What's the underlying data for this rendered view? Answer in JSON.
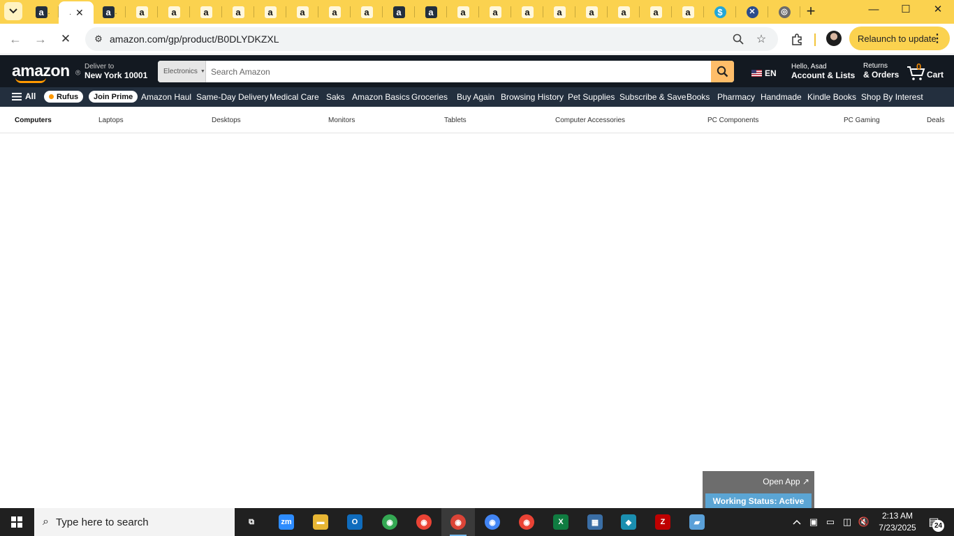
{
  "browser": {
    "tabs": [
      {
        "icon": "amazon-dark-icon",
        "glyph": "a",
        "style": "dark",
        "dot": "."
      },
      {
        "icon": "amazon-icon",
        "glyph": "",
        "style": "active",
        "dot": "."
      },
      {
        "icon": "amazon-dark-icon",
        "glyph": "a",
        "style": "dark",
        "dot": "."
      },
      {
        "icon": "amazon-icon",
        "glyph": "a",
        "style": "light"
      },
      {
        "icon": "amazon-icon",
        "glyph": "a",
        "style": "light"
      },
      {
        "icon": "amazon-icon",
        "glyph": "a",
        "style": "light"
      },
      {
        "icon": "amazon-icon",
        "glyph": "a",
        "style": "light"
      },
      {
        "icon": "amazon-icon",
        "glyph": "a",
        "style": "light"
      },
      {
        "icon": "amazon-icon",
        "glyph": "a",
        "style": "light"
      },
      {
        "icon": "amazon-icon",
        "glyph": "a",
        "style": "light"
      },
      {
        "icon": "amazon-icon",
        "glyph": "a",
        "style": "light"
      },
      {
        "icon": "amazon-dark-icon",
        "glyph": "a",
        "style": "dark"
      },
      {
        "icon": "amazon-dark-icon",
        "glyph": "a",
        "style": "dark"
      },
      {
        "icon": "amazon-icon",
        "glyph": "a",
        "style": "light"
      },
      {
        "icon": "amazon-icon",
        "glyph": "a",
        "style": "light"
      },
      {
        "icon": "amazon-icon",
        "glyph": "a",
        "style": "light"
      },
      {
        "icon": "amazon-icon",
        "glyph": "a",
        "style": "light"
      },
      {
        "icon": "amazon-icon",
        "glyph": "a",
        "style": "light"
      },
      {
        "icon": "amazon-icon",
        "glyph": "a",
        "style": "light"
      },
      {
        "icon": "amazon-icon",
        "glyph": "a",
        "style": "light"
      },
      {
        "icon": "amazon-icon",
        "glyph": "a",
        "style": "light"
      },
      {
        "icon": "dollar-icon",
        "glyph": "$",
        "style": "blue-s"
      },
      {
        "icon": "cross-logo-icon",
        "glyph": "✕",
        "style": "navy-x"
      },
      {
        "icon": "cloud-icon",
        "glyph": "◎",
        "style": "cloud"
      }
    ],
    "url": "amazon.com/gp/product/B0DLYDKZXL",
    "relaunch_label": "Relaunch to update"
  },
  "amazon": {
    "logo_text": "amazon",
    "deliver_line1": "Deliver to",
    "deliver_line2": "New York 10001",
    "search_category": "Electronics",
    "search_placeholder": "Search Amazon",
    "language": "EN",
    "account_line1": "Hello, Asad",
    "account_line2": "Account & Lists",
    "returns_line1": "Returns",
    "returns_line2": "& Orders",
    "cart_count": "0",
    "cart_label": "Cart",
    "nav_all": "All",
    "nav_rufus": "Rufus",
    "nav_join_prime": "Join Prime",
    "nav_items": [
      "Amazon Haul",
      "Same-Day Delivery",
      "Medical Care",
      "Saks",
      "Amazon Basics",
      "Groceries",
      "Buy Again",
      "Browsing History",
      "Pet Supplies",
      "Subscribe & Save",
      "Books",
      "Pharmacy",
      "Handmade",
      "Kindle Books",
      "Shop By Interest"
    ],
    "subnav_items": [
      "Computers",
      "Laptops",
      "Desktops",
      "Monitors",
      "Tablets",
      "Computer Accessories",
      "PC Components",
      "PC Gaming",
      "Deals"
    ]
  },
  "widget": {
    "open_app": "Open App ↗",
    "working_status": "Working Status: Active"
  },
  "taskbar": {
    "search_placeholder": "Type here to search",
    "time": "2:13 AM",
    "date": "7/23/2025",
    "notification_count": "24",
    "apps": [
      {
        "name": "task-view-icon",
        "glyph": "⧉",
        "bg": "transparent"
      },
      {
        "name": "zoom-icon",
        "glyph": "zm",
        "bg": "#2d8cff"
      },
      {
        "name": "file-explorer-icon",
        "glyph": "▬",
        "bg": "#e8b634"
      },
      {
        "name": "outlook-icon",
        "glyph": "O",
        "bg": "#0f6cbd"
      },
      {
        "name": "chrome-icon",
        "glyph": "◉",
        "bg": "#34a853"
      },
      {
        "name": "chrome-icon",
        "glyph": "◉",
        "bg": "#ea4335"
      },
      {
        "name": "chrome-icon",
        "glyph": "◉",
        "bg": "#db4437"
      },
      {
        "name": "chrome-icon",
        "glyph": "◉",
        "bg": "#4285f4"
      },
      {
        "name": "chrome-icon",
        "glyph": "◉",
        "bg": "#ea4335"
      },
      {
        "name": "excel-icon",
        "glyph": "X",
        "bg": "#107c41"
      },
      {
        "name": "calculator-icon",
        "glyph": "▦",
        "bg": "#3a6ea5"
      },
      {
        "name": "diamond-app-icon",
        "glyph": "◆",
        "bg": "#1b8fb0"
      },
      {
        "name": "filezilla-icon",
        "glyph": "Z",
        "bg": "#bf0000"
      },
      {
        "name": "notes-app-icon",
        "glyph": "▰",
        "bg": "#5aa0d8"
      }
    ]
  }
}
